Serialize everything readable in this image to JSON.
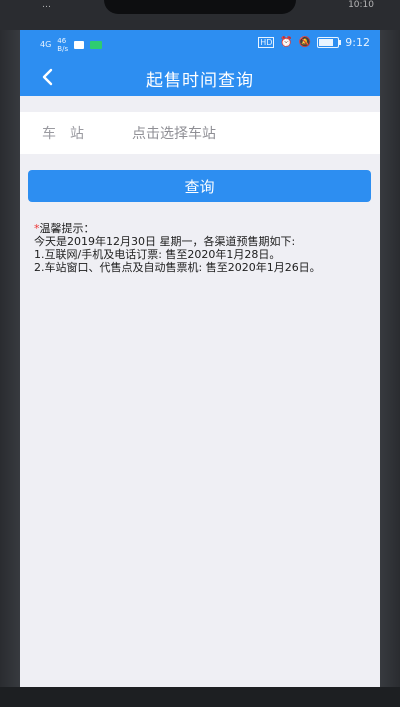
{
  "outer": {
    "left_text": "…",
    "right_text": "10:10"
  },
  "status_bar": {
    "signal_1": "4G",
    "signal_2": "46\nB/s",
    "time": "9:12",
    "battery_text": "87"
  },
  "app_bar": {
    "title": "起售时间查询"
  },
  "station": {
    "label": "车站",
    "placeholder": "点击选择车站"
  },
  "query_button": {
    "label": "查询"
  },
  "notice": {
    "star": "*",
    "heading": "温馨提示：",
    "line1": "今天是2019年12月30日 星期一，各渠道预售期如下:",
    "line2": "1.互联网/手机及电话订票: 售至2020年1月28日。",
    "line3": "2.车站窗口、代售点及自动售票机: 售至2020年1月26日。"
  },
  "colors": {
    "primary": "#2d8ef1",
    "background": "#efeff4",
    "accent_star": "#e33333"
  },
  "icons": {
    "back": "back-chevron-icon",
    "alarm": "alarm-icon",
    "mute": "mute-icon",
    "battery": "battery-icon"
  }
}
